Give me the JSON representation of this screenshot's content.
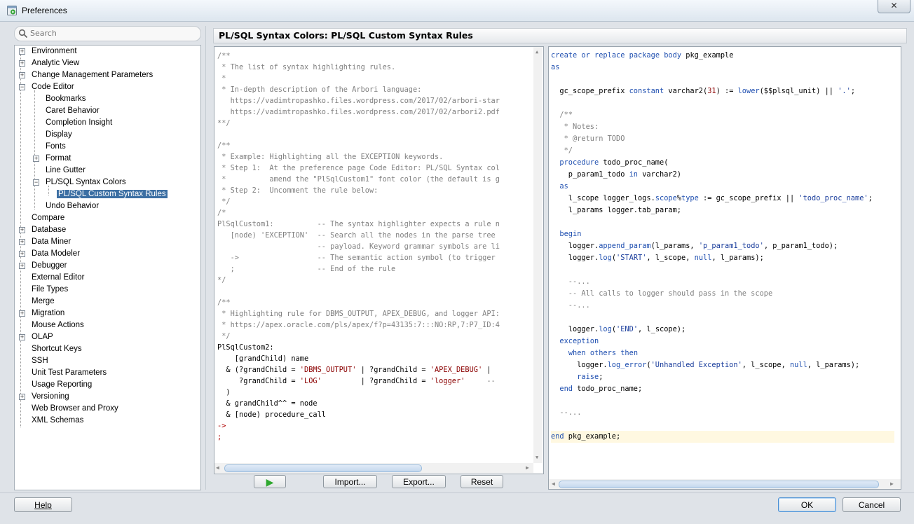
{
  "window": {
    "title": "Preferences",
    "close_glyph": "✕"
  },
  "search": {
    "placeholder": "Search",
    "value": ""
  },
  "tree": {
    "items": [
      {
        "label": "Environment"
      },
      {
        "label": "Analytic View"
      },
      {
        "label": "Change Management Parameters"
      },
      {
        "label": "Code Editor"
      },
      {
        "label": "Bookmarks"
      },
      {
        "label": "Caret Behavior"
      },
      {
        "label": "Completion Insight"
      },
      {
        "label": "Display"
      },
      {
        "label": "Fonts"
      },
      {
        "label": "Format"
      },
      {
        "label": "Line Gutter"
      },
      {
        "label": "PL/SQL Syntax Colors"
      },
      {
        "label": "PL/SQL Custom Syntax Rules"
      },
      {
        "label": "Undo Behavior"
      },
      {
        "label": "Compare"
      },
      {
        "label": "Database"
      },
      {
        "label": "Data Miner"
      },
      {
        "label": "Data Modeler"
      },
      {
        "label": "Debugger"
      },
      {
        "label": "External Editor"
      },
      {
        "label": "File Types"
      },
      {
        "label": "Merge"
      },
      {
        "label": "Migration"
      },
      {
        "label": "Mouse Actions"
      },
      {
        "label": "OLAP"
      },
      {
        "label": "Shortcut Keys"
      },
      {
        "label": "SSH"
      },
      {
        "label": "Unit Test Parameters"
      },
      {
        "label": "Usage Reporting"
      },
      {
        "label": "Versioning"
      },
      {
        "label": "Web Browser and Proxy"
      },
      {
        "label": "XML Schemas"
      }
    ]
  },
  "page": {
    "heading": "PL/SQL Syntax Colors: PL/SQL Custom Syntax Rules"
  },
  "rules_editor": {
    "lines": [
      "/**",
      " * The list of syntax highlighting rules.",
      " *",
      " * In-depth description of the Arbori language:",
      "   https://vadimtropashko.files.wordpress.com/2017/02/arbori-star",
      "   https://vadimtropashko.files.wordpress.com/2017/02/arbori2.pdf",
      "**/",
      "",
      "/**",
      " * Example: Highlighting all the EXCEPTION keywords.",
      " * Step 1:  At the preference page Code Editor: PL/SQL Syntax col",
      " *          amend the \"PlSqlCustom1\" font color (the default is g",
      " * Step 2:  Uncomment the rule below:",
      " */",
      "/*",
      "PlSqlCustom1:          -- The syntax highlighter expects a rule n",
      "   [node) 'EXCEPTION'  -- Search all the nodes in the parse tree",
      "                       -- payload. Keyword grammar symbols are li",
      "   ->                  -- The semantic action symbol (to trigger",
      "   ;                   -- End of the rule",
      "*/",
      "",
      "/**",
      " * Highlighting rule for DBMS_OUTPUT, APEX_DEBUG, and logger API:",
      " * https://apex.oracle.com/pls/apex/f?p=43135:7:::NO:RP,7:P7_ID:4",
      " */",
      "PlSqlCustom2:",
      "    [grandChild) name",
      "  & (?grandChild = 'DBMS_OUTPUT' | ?grandChild = 'APEX_DEBUG' |",
      "     ?grandChild = 'LOG'         | ?grandChild = 'logger'     --",
      "  )",
      "  & grandChild^^ = node",
      "  & [node) procedure_call",
      "->",
      ";"
    ]
  },
  "preview_editor": {
    "lines": [
      "create or replace package body pkg_example",
      "as",
      "",
      "  gc_scope_prefix constant varchar2(31) := lower($$plsql_unit) || '.';",
      "",
      "  /**",
      "   * Notes:",
      "   * @return TODO",
      "   */",
      "  procedure todo_proc_name(",
      "    p_param1_todo in varchar2)",
      "  as",
      "    l_scope logger_logs.scope%type := gc_scope_prefix || 'todo_proc_name';",
      "    l_params logger.tab_param;",
      "",
      "  begin",
      "    logger.append_param(l_params, 'p_param1_todo', p_param1_todo);",
      "    logger.log('START', l_scope, null, l_params);",
      "",
      "    --...",
      "    -- All calls to logger should pass in the scope",
      "    --...",
      "",
      "    logger.log('END', l_scope);",
      "  exception",
      "    when others then",
      "      logger.log_error('Unhandled Exception', l_scope, null, l_params);",
      "      raise;",
      "  end todo_proc_name;",
      "",
      "  --...",
      "",
      "end pkg_example;"
    ]
  },
  "buttons": {
    "run": "▶",
    "import": "Import...",
    "export": "Export...",
    "reset": "Reset",
    "help": "Help",
    "ok": "OK",
    "cancel": "Cancel"
  },
  "colors": {
    "keyword": "#1f4fb0",
    "comment": "#808080",
    "string": "#8b0000",
    "selection": "#3c6fa3",
    "run_icon": "#2fa82f"
  }
}
